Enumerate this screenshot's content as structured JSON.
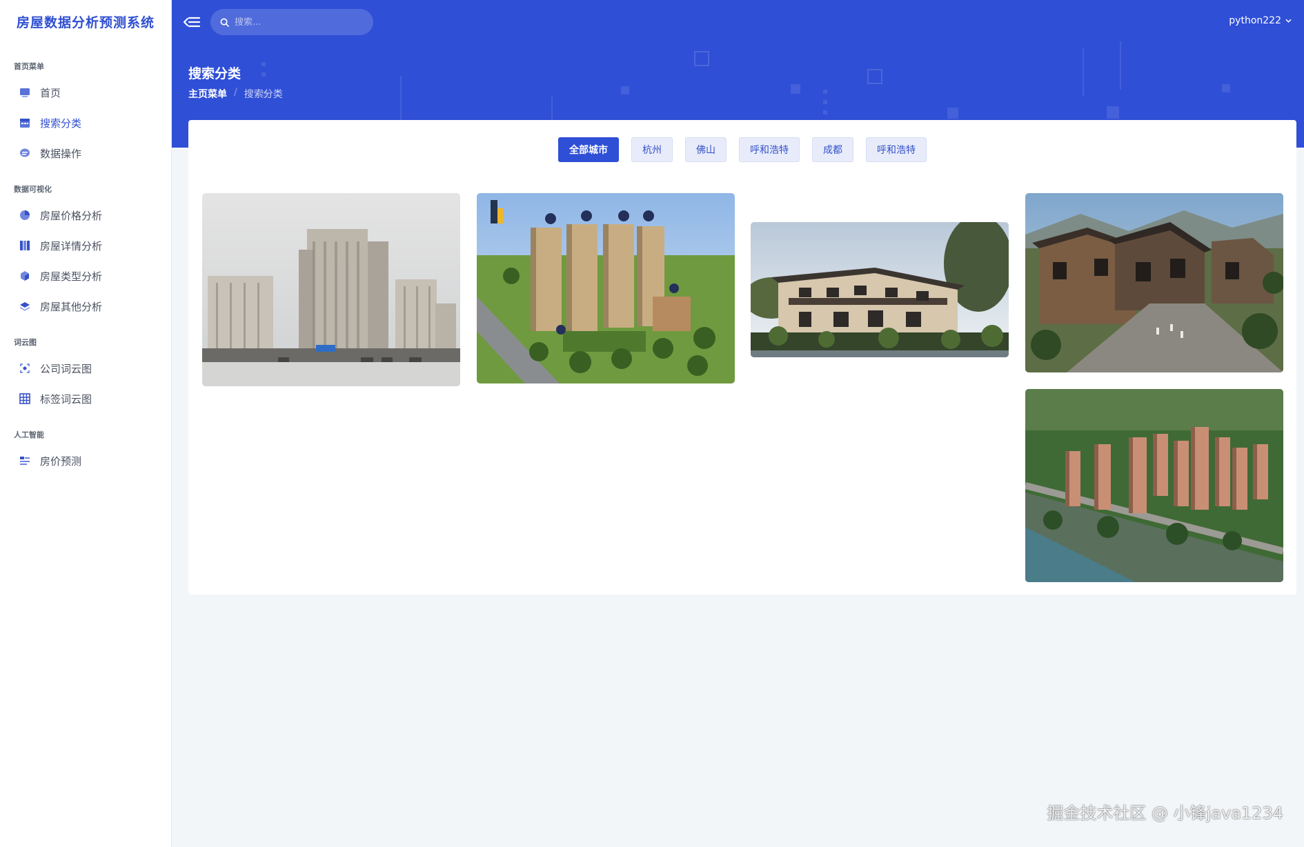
{
  "app": {
    "title": "房屋数据分析预测系统"
  },
  "sidebar": {
    "sections": [
      {
        "label": "首页菜单",
        "items": [
          {
            "label": "首页",
            "icon": "dashboard-icon"
          },
          {
            "label": "搜索分类",
            "icon": "calendar-icon",
            "active": true
          },
          {
            "label": "数据操作",
            "icon": "chat-icon"
          }
        ]
      },
      {
        "label": "数据可视化",
        "items": [
          {
            "label": "房屋价格分析",
            "icon": "pie-chart-icon"
          },
          {
            "label": "房屋详情分析",
            "icon": "columns-icon"
          },
          {
            "label": "房屋类型分析",
            "icon": "cube-icon"
          },
          {
            "label": "房屋其他分析",
            "icon": "layers-icon"
          }
        ]
      },
      {
        "label": "词云图",
        "items": [
          {
            "label": "公司词云图",
            "icon": "crosshair-icon"
          },
          {
            "label": "标签词云图",
            "icon": "grid-icon"
          }
        ]
      },
      {
        "label": "人工智能",
        "items": [
          {
            "label": "房价预测",
            "icon": "list-icon"
          }
        ]
      }
    ]
  },
  "header": {
    "search_placeholder": "搜索...",
    "username": "python222",
    "page_title": "搜索分类",
    "breadcrumb": {
      "parent": "主页菜单",
      "separator": "/",
      "current": "搜索分类"
    }
  },
  "filters": {
    "items": [
      "全部城市",
      "杭州",
      "佛山",
      "呼和浩特",
      "成都",
      "呼和浩特"
    ],
    "active_index": 0
  },
  "gallery": {
    "photos": [
      "highrise-apartments-photo",
      "residential-complex-rendering",
      "villa-rendering",
      "townhouse-village-rendering",
      "highrise-complex-aerial-rendering"
    ]
  },
  "watermark": "掘金技术社区 @ 小锋java1234",
  "colors": {
    "primary": "#2f4fd6",
    "brand_text": "#2f4fd1",
    "background": "#f3f6f8"
  }
}
